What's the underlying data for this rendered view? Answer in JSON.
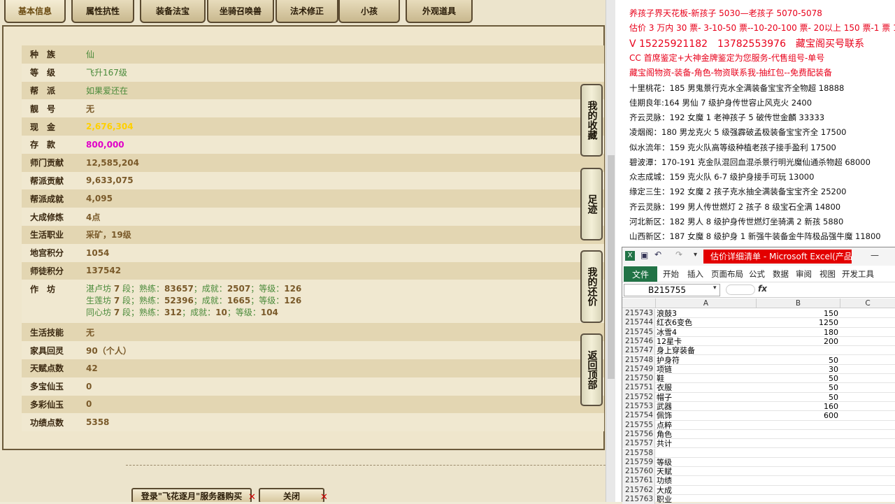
{
  "tabs": [
    "基本信息",
    "属性抗性",
    "装备法宝",
    "坐骑召唤兽",
    "法术修正",
    "小孩",
    "外观道具"
  ],
  "info_rows": [
    {
      "label": "种　族",
      "value": "仙",
      "style": "green"
    },
    {
      "label": "等　级",
      "value": "飞升167级",
      "style": "green"
    },
    {
      "label": "帮　派",
      "value": "如果爱还在",
      "style": "green"
    },
    {
      "label": "靓　号",
      "value": "无",
      "style": "brown"
    },
    {
      "label": "现　金",
      "value": "2,676,304",
      "style": "yellow"
    },
    {
      "label": "存　款",
      "value": "800,000",
      "style": "pink"
    },
    {
      "label": "师门贡献",
      "value": "12,585,204",
      "style": "brown"
    },
    {
      "label": "帮派贡献",
      "value": "9,633,075",
      "style": "brown"
    },
    {
      "label": "帮派成就",
      "value": "4,095",
      "style": "brown"
    },
    {
      "label": "大成修炼",
      "value": "4点",
      "style": "brown"
    },
    {
      "label": "生活职业",
      "value": "采矿，19级",
      "style": "brown"
    },
    {
      "label": "地宫积分",
      "value": "1054",
      "style": "brown"
    },
    {
      "label": "师徒积分",
      "value": "137542",
      "style": "brown"
    }
  ],
  "zuofang": {
    "label": "作　坊",
    "lines": [
      {
        "name": "湛卢坊",
        "level": "7",
        "shulian": "83657",
        "chengjiu": "2507",
        "dengji": "126"
      },
      {
        "name": "生莲坊",
        "level": "7",
        "shulian": "52396",
        "chengjiu": "1665",
        "dengji": "126"
      },
      {
        "name": "同心坊",
        "level": "7",
        "shulian": "312",
        "chengjiu": "10",
        "dengji": "104"
      }
    ],
    "words": {
      "duan": "段；熟练：",
      "cj": "；成就：",
      "dj": "；等级："
    }
  },
  "info_rows2": [
    {
      "label": "生活技能",
      "value": "无",
      "style": "brown"
    },
    {
      "label": "家具回灵",
      "value": "90（个人）",
      "style": "brown"
    },
    {
      "label": "天赋点数",
      "value": "42",
      "style": "brown"
    },
    {
      "label": "多宝仙玉",
      "value": "0",
      "style": "brown"
    },
    {
      "label": "多彩仙玉",
      "value": "0",
      "style": "brown"
    },
    {
      "label": "功绩点数",
      "value": "5358",
      "style": "brown"
    }
  ],
  "side_buttons": [
    "我的收藏",
    "足迹",
    "我的还价",
    "返回顶部"
  ],
  "bottom_buttons": {
    "login": "登录\"飞花逐月\"服务器购买",
    "close": "关闭"
  },
  "notes": [
    {
      "text": "养孩子界天花板-新孩子 5030—老孩子 5070-5078",
      "style": "red"
    },
    {
      "text": "估价 3 万内 30 票- 3-10-50 票--10-20-100 票- 20以上 150 票-1 票 1 元",
      "style": "red"
    },
    {
      "text": "V 15225921182　13782553976　藏宝阁买号联系",
      "style": "red big"
    },
    {
      "text": "CC 首席鉴定+大神金牌鉴定为您服务-代售组号-单号",
      "style": "red"
    },
    {
      "text": "藏宝阁物资-装备-角色-物资联系我-抽红包--免费配装备",
      "style": "red"
    },
    {
      "text": "十里桃花：185 男鬼景行克水全满装备宝宝齐全物超 18888",
      "style": "black"
    },
    {
      "text": "佳期良年:164 男仙 7 级护身传世容止风克火 2400",
      "style": "black"
    },
    {
      "text": "齐云灵脉：192 女魔 1 老神孩子 5 破传世金麟 33333",
      "style": "black"
    },
    {
      "text": "凌烟阁：180 男龙克火 5 级强霹破孟极装备宝宝齐全 17500",
      "style": "black"
    },
    {
      "text": "似水流年：159 克火队高等级种植老孩子接手盈利 17500",
      "style": "black"
    },
    {
      "text": "碧波潭：170-191 克金队混回血混杀景行明光魔仙通杀物超 68000",
      "style": "black"
    },
    {
      "text": "众志成城：159 克火队 6-7 级护身接手可玩 13000",
      "style": "black"
    },
    {
      "text": "缘定三生：192 女魔 2 孩子克水抽全满装备宝宝齐全 25200",
      "style": "black"
    },
    {
      "text": "齐云灵脉：199 男人传世燃灯 2 孩子 8 级宝石全满 14800",
      "style": "black"
    },
    {
      "text": "河北新区：182 男人 8 级护身传世燃灯坐骑满 2 新孩 5880",
      "style": "black"
    },
    {
      "text": "山西新区：187 女魔 8 级护身 1 新强牛装备金牛阵极品强牛魔 11800",
      "style": "black"
    }
  ],
  "excel": {
    "title": "估价详细清单 - Microsoft Excel(产品...",
    "ribbon_tabs": [
      "文件",
      "开始",
      "插入",
      "页面布局",
      "公式",
      "数据",
      "审阅",
      "视图",
      "开发工具"
    ],
    "name_box": "B215755",
    "fx": "fx",
    "col_headers": [
      "A",
      "B",
      "C"
    ],
    "rows": [
      {
        "n": "215743",
        "a": "浪鼓3",
        "b": "150"
      },
      {
        "n": "215744",
        "a": "红衣6变色",
        "b": "1250"
      },
      {
        "n": "215745",
        "a": "冰雪4",
        "b": "180"
      },
      {
        "n": "215746",
        "a": "12星卡",
        "b": "200"
      },
      {
        "n": "215747",
        "a": "身上穿装备",
        "b": ""
      },
      {
        "n": "215748",
        "a": "护身符",
        "b": "50"
      },
      {
        "n": "215749",
        "a": "项链",
        "b": "30"
      },
      {
        "n": "215750",
        "a": "鞋",
        "b": "50"
      },
      {
        "n": "215751",
        "a": "衣服",
        "b": "50"
      },
      {
        "n": "215752",
        "a": "帽子",
        "b": "50"
      },
      {
        "n": "215753",
        "a": "武器",
        "b": "160"
      },
      {
        "n": "215754",
        "a": "佩饰",
        "b": "600"
      },
      {
        "n": "215755",
        "a": "点粹",
        "b": ""
      },
      {
        "n": "215756",
        "a": "角色",
        "b": ""
      },
      {
        "n": "215757",
        "a": "共计",
        "b": ""
      },
      {
        "n": "215758",
        "a": "",
        "b": ""
      },
      {
        "n": "215759",
        "a": "等级",
        "b": ""
      },
      {
        "n": "215760",
        "a": "天赋",
        "b": ""
      },
      {
        "n": "215761",
        "a": "功绩",
        "b": ""
      },
      {
        "n": "215762",
        "a": "大成",
        "b": ""
      },
      {
        "n": "215763",
        "a": "职业",
        "b": ""
      }
    ]
  }
}
